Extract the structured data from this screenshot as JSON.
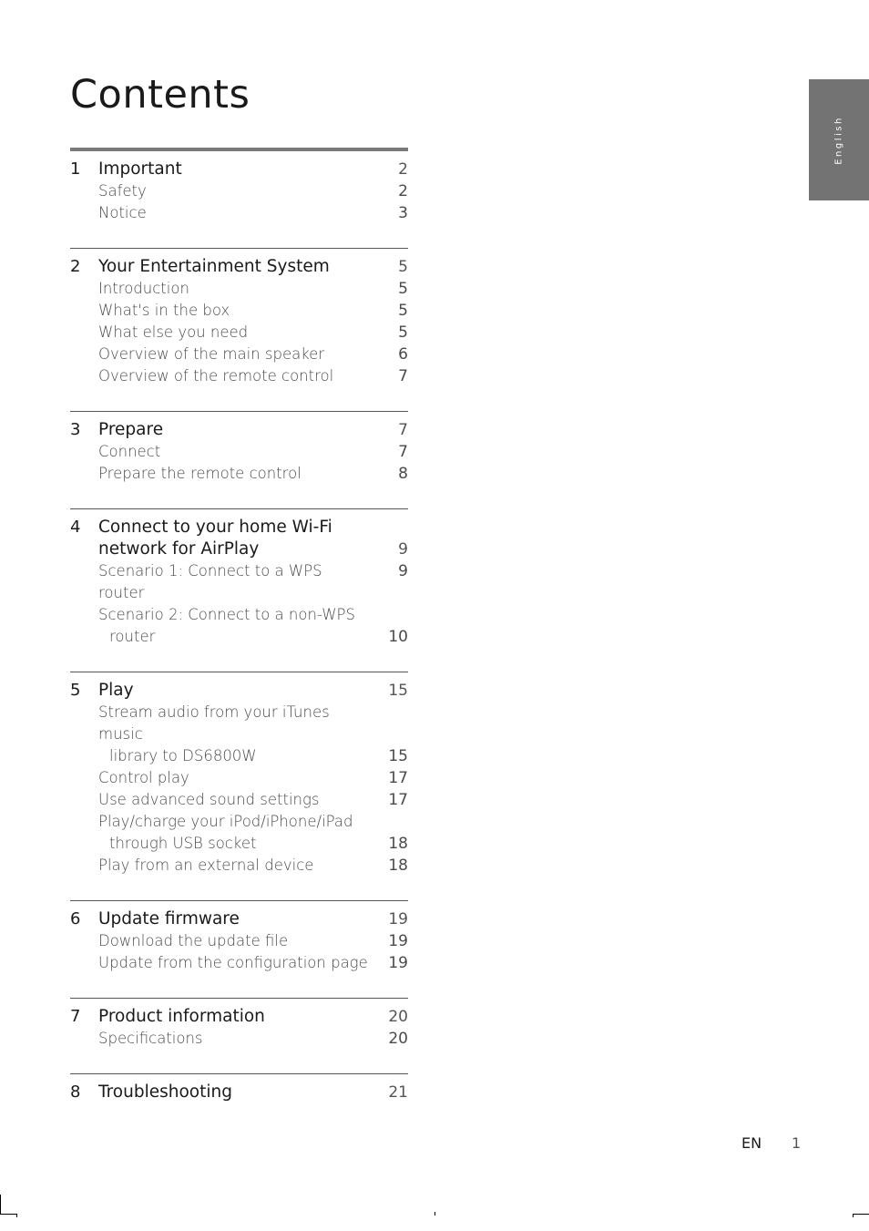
{
  "title": "Contents",
  "language_tab": "English",
  "footer": {
    "lang": "EN",
    "page": "1"
  },
  "sections": [
    {
      "num": "1",
      "title": "Important",
      "page": "2",
      "items": [
        {
          "label": "Safety",
          "page": "2"
        },
        {
          "label": "Notice",
          "page": "3"
        }
      ]
    },
    {
      "num": "2",
      "title": "Your Entertainment System",
      "page": "5",
      "items": [
        {
          "label": "Introduction",
          "page": "5"
        },
        {
          "label": "What's in the box",
          "page": "5"
        },
        {
          "label": "What else you need",
          "page": "5"
        },
        {
          "label": "Overview of the main speaker",
          "page": "6"
        },
        {
          "label": "Overview of the remote control",
          "page": "7"
        }
      ]
    },
    {
      "num": "3",
      "title": "Prepare",
      "page": "7",
      "items": [
        {
          "label": "Connect",
          "page": "7"
        },
        {
          "label": "Prepare the remote control",
          "page": "8"
        }
      ]
    },
    {
      "num": "4",
      "title": "Connect to your home Wi-Fi",
      "title2": "network for AirPlay",
      "page": "9",
      "items": [
        {
          "label": "Scenario 1: Connect to a WPS router",
          "page": "9"
        },
        {
          "label": "Scenario 2: Connect to a non-WPS",
          "label2": "router",
          "page": "10"
        }
      ]
    },
    {
      "num": "5",
      "title": "Play",
      "page": "15",
      "items": [
        {
          "label": "Stream audio from your iTunes music",
          "label2": "library to DS6800W",
          "page": "15"
        },
        {
          "label": "Control play",
          "page": "17"
        },
        {
          "label": "Use advanced sound settings",
          "page": "17"
        },
        {
          "label": "Play/charge your iPod/iPhone/iPad",
          "label2": "through USB socket",
          "page": "18"
        },
        {
          "label": "Play from an external device",
          "page": "18"
        }
      ]
    },
    {
      "num": "6",
      "title": "Update firmware",
      "page": "19",
      "items": [
        {
          "label": "Download the update file",
          "page": "19"
        },
        {
          "label": "Update from the configuration page",
          "page": "19"
        }
      ]
    },
    {
      "num": "7",
      "title": "Product information",
      "page": "20",
      "items": [
        {
          "label": "Specifications",
          "page": "20"
        }
      ]
    },
    {
      "num": "8",
      "title": "Troubleshooting",
      "page": "21",
      "items": []
    }
  ]
}
